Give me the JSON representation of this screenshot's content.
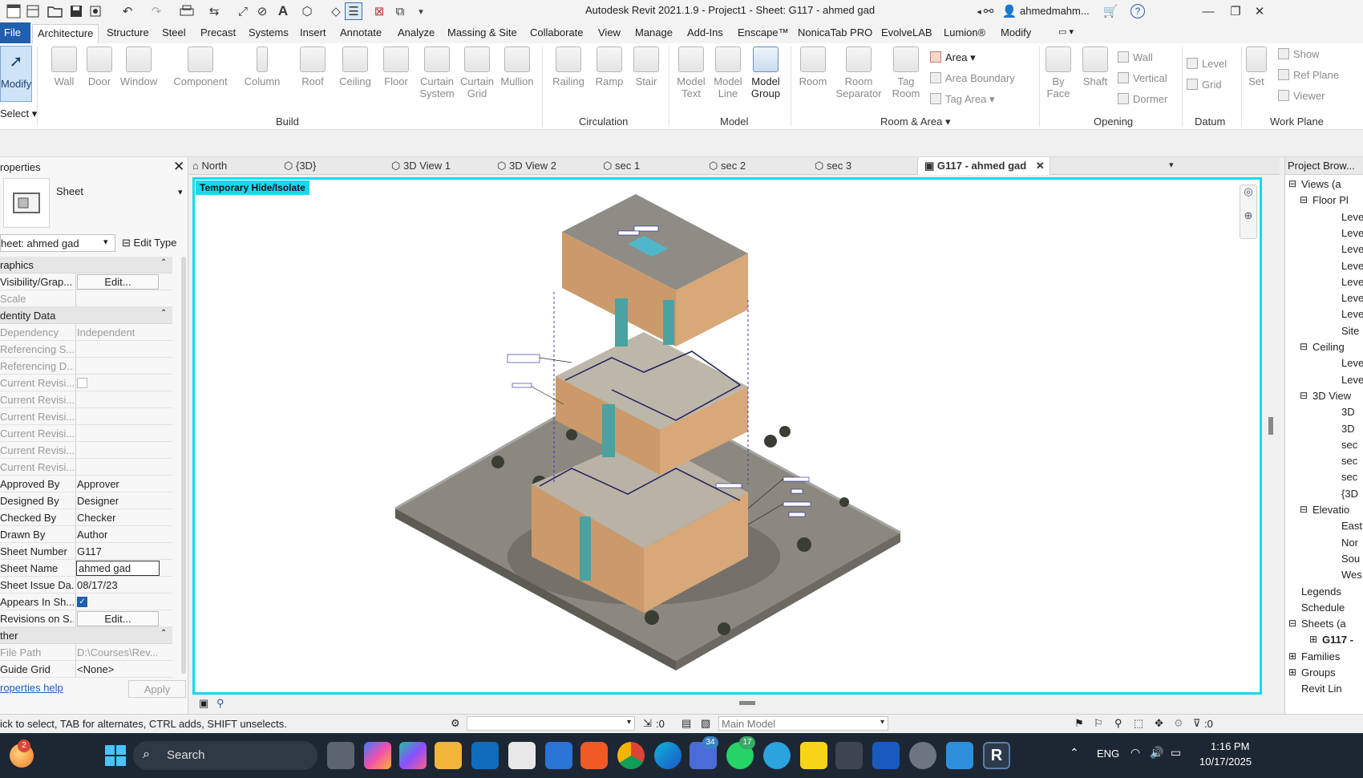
{
  "titlebar": {
    "title": "Autodesk Revit 2021.1.9 - Project1 - Sheet: G117 - ahmed gad",
    "user": "ahmedmahm...",
    "help": "?"
  },
  "ribbon_tabs": [
    {
      "label": "File"
    },
    {
      "label": "Architecture"
    },
    {
      "label": "Structure"
    },
    {
      "label": "Steel"
    },
    {
      "label": "Precast"
    },
    {
      "label": "Systems"
    },
    {
      "label": "Insert"
    },
    {
      "label": "Annotate"
    },
    {
      "label": "Analyze"
    },
    {
      "label": "Massing & Site"
    },
    {
      "label": "Collaborate"
    },
    {
      "label": "View"
    },
    {
      "label": "Manage"
    },
    {
      "label": "Add-Ins"
    },
    {
      "label": "Enscape™"
    },
    {
      "label": "NonicaTab PRO"
    },
    {
      "label": "EvolveLAB"
    },
    {
      "label": "Lumion®"
    },
    {
      "label": "Modify"
    }
  ],
  "ribbon": {
    "modify": "Modify",
    "select": "Select",
    "build": {
      "wall": "Wall",
      "door": "Door",
      "window": "Window",
      "component": "Component",
      "column": "Column",
      "roof": "Roof",
      "ceiling": "Ceiling",
      "floor": "Floor",
      "curtain_system_1": "Curtain",
      "curtain_system_2": "System",
      "curtain_grid_1": "Curtain",
      "curtain_grid_2": "Grid",
      "mullion": "Mullion",
      "group": "Build"
    },
    "circulation": {
      "railing": "Railing",
      "ramp": "Ramp",
      "stair": "Stair",
      "group": "Circulation"
    },
    "model": {
      "model_text_1": "Model",
      "model_text_2": "Text",
      "model_line_1": "Model",
      "model_line_2": "Line",
      "model_group_1": "Model",
      "model_group_2": "Group",
      "group": "Model"
    },
    "room": {
      "room": "Room",
      "room_sep_1": "Room",
      "room_sep_2": "Separator",
      "tag_room_1": "Tag",
      "tag_room_2": "Room",
      "area": "Area",
      "area_boundary": "Area  Boundary",
      "tag_area": "Tag  Area",
      "group": "Room & Area"
    },
    "opening": {
      "by_face_1": "By",
      "by_face_2": "Face",
      "shaft": "Shaft",
      "wall": "Wall",
      "vertical": "Vertical",
      "dormer": "Dormer",
      "group": "Opening"
    },
    "datum": {
      "level": "Level",
      "grid": "Grid",
      "group": "Datum"
    },
    "workplane": {
      "set": "Set",
      "show": "Show",
      "ref_plane": "Ref  Plane",
      "viewer": "Viewer",
      "group": "Work Plane"
    }
  },
  "properties": {
    "title": "roperties",
    "type_name": "Sheet",
    "selector": "heet: ahmed gad",
    "edit_type": "Edit Type",
    "sections": {
      "graphics": "raphics",
      "identity": "dentity Data",
      "other": "ther"
    },
    "rows": {
      "visibility": {
        "k": "Visibility/Grap...",
        "v": "Edit..."
      },
      "scale": {
        "k": "Scale",
        "v": ""
      },
      "dependency": {
        "k": "Dependency",
        "v": "Independent"
      },
      "ref_s": {
        "k": "Referencing S...",
        "v": ""
      },
      "ref_d": {
        "k": "Referencing D...",
        "v": ""
      },
      "cur_rev1": {
        "k": "Current Revisi...",
        "v": ""
      },
      "cur_rev2": {
        "k": "Current Revisi...",
        "v": ""
      },
      "cur_rev3": {
        "k": "Current Revisi...",
        "v": ""
      },
      "cur_rev4": {
        "k": "Current Revisi...",
        "v": ""
      },
      "cur_rev5": {
        "k": "Current Revisi...",
        "v": ""
      },
      "cur_rev6": {
        "k": "Current Revisi...",
        "v": ""
      },
      "approved": {
        "k": "Approved By",
        "v": "Approver"
      },
      "designed": {
        "k": "Designed By",
        "v": "Designer"
      },
      "checked": {
        "k": "Checked By",
        "v": "Checker"
      },
      "drawn": {
        "k": "Drawn By",
        "v": "Author"
      },
      "sheet_number": {
        "k": "Sheet Number",
        "v": "G117"
      },
      "sheet_name": {
        "k": "Sheet Name",
        "v": "ahmed gad"
      },
      "issue_date": {
        "k": "Sheet Issue Da...",
        "v": "08/17/23"
      },
      "appears": {
        "k": "Appears In Sh...",
        "v": ""
      },
      "revisions": {
        "k": "Revisions on S...",
        "v": "Edit..."
      },
      "file_path": {
        "k": "File Path",
        "v": "D:\\Courses\\Rev..."
      },
      "guide_grid": {
        "k": "Guide Grid",
        "v": "<None>"
      }
    },
    "help": "roperties help",
    "apply": "Apply"
  },
  "view_tabs": [
    {
      "label": "North"
    },
    {
      "label": "{3D}"
    },
    {
      "label": "3D View 1"
    },
    {
      "label": "3D View 2"
    },
    {
      "label": "sec 1"
    },
    {
      "label": "sec 2"
    },
    {
      "label": "sec 3"
    },
    {
      "label": "G117 - ahmed gad"
    }
  ],
  "canvas": {
    "temp_hide": "Temporary Hide/Isolate"
  },
  "project_browser": {
    "title": "Project Brow...",
    "items": [
      "Views (a",
      "Floor Pl",
      "Leve",
      "Leve",
      "Leve",
      "Leve",
      "Leve",
      "Leve",
      "Leve",
      "Site",
      "Ceiling",
      "Leve",
      "Leve",
      "3D View",
      "3D",
      "3D",
      "sec",
      "sec",
      "sec",
      "{3D",
      "Elevatio",
      "East",
      "Nor",
      "Sou",
      "Wes",
      "Legends",
      "Schedule",
      "Sheets (a",
      "G117 -",
      "Families",
      "Groups",
      "Revit Lin"
    ]
  },
  "status": {
    "hint": "ick to select, TAB for alternates, CTRL adds, SHIFT unselects.",
    "sel_count": ":0",
    "model": "Main Model",
    "filter_count": ":0"
  },
  "taskbar": {
    "search": "Search",
    "lang": "ENG",
    "time": "1:16 PM",
    "date": "10/17/2025",
    "badge_1": "2",
    "badge_2": "34",
    "badge_3": "17"
  }
}
